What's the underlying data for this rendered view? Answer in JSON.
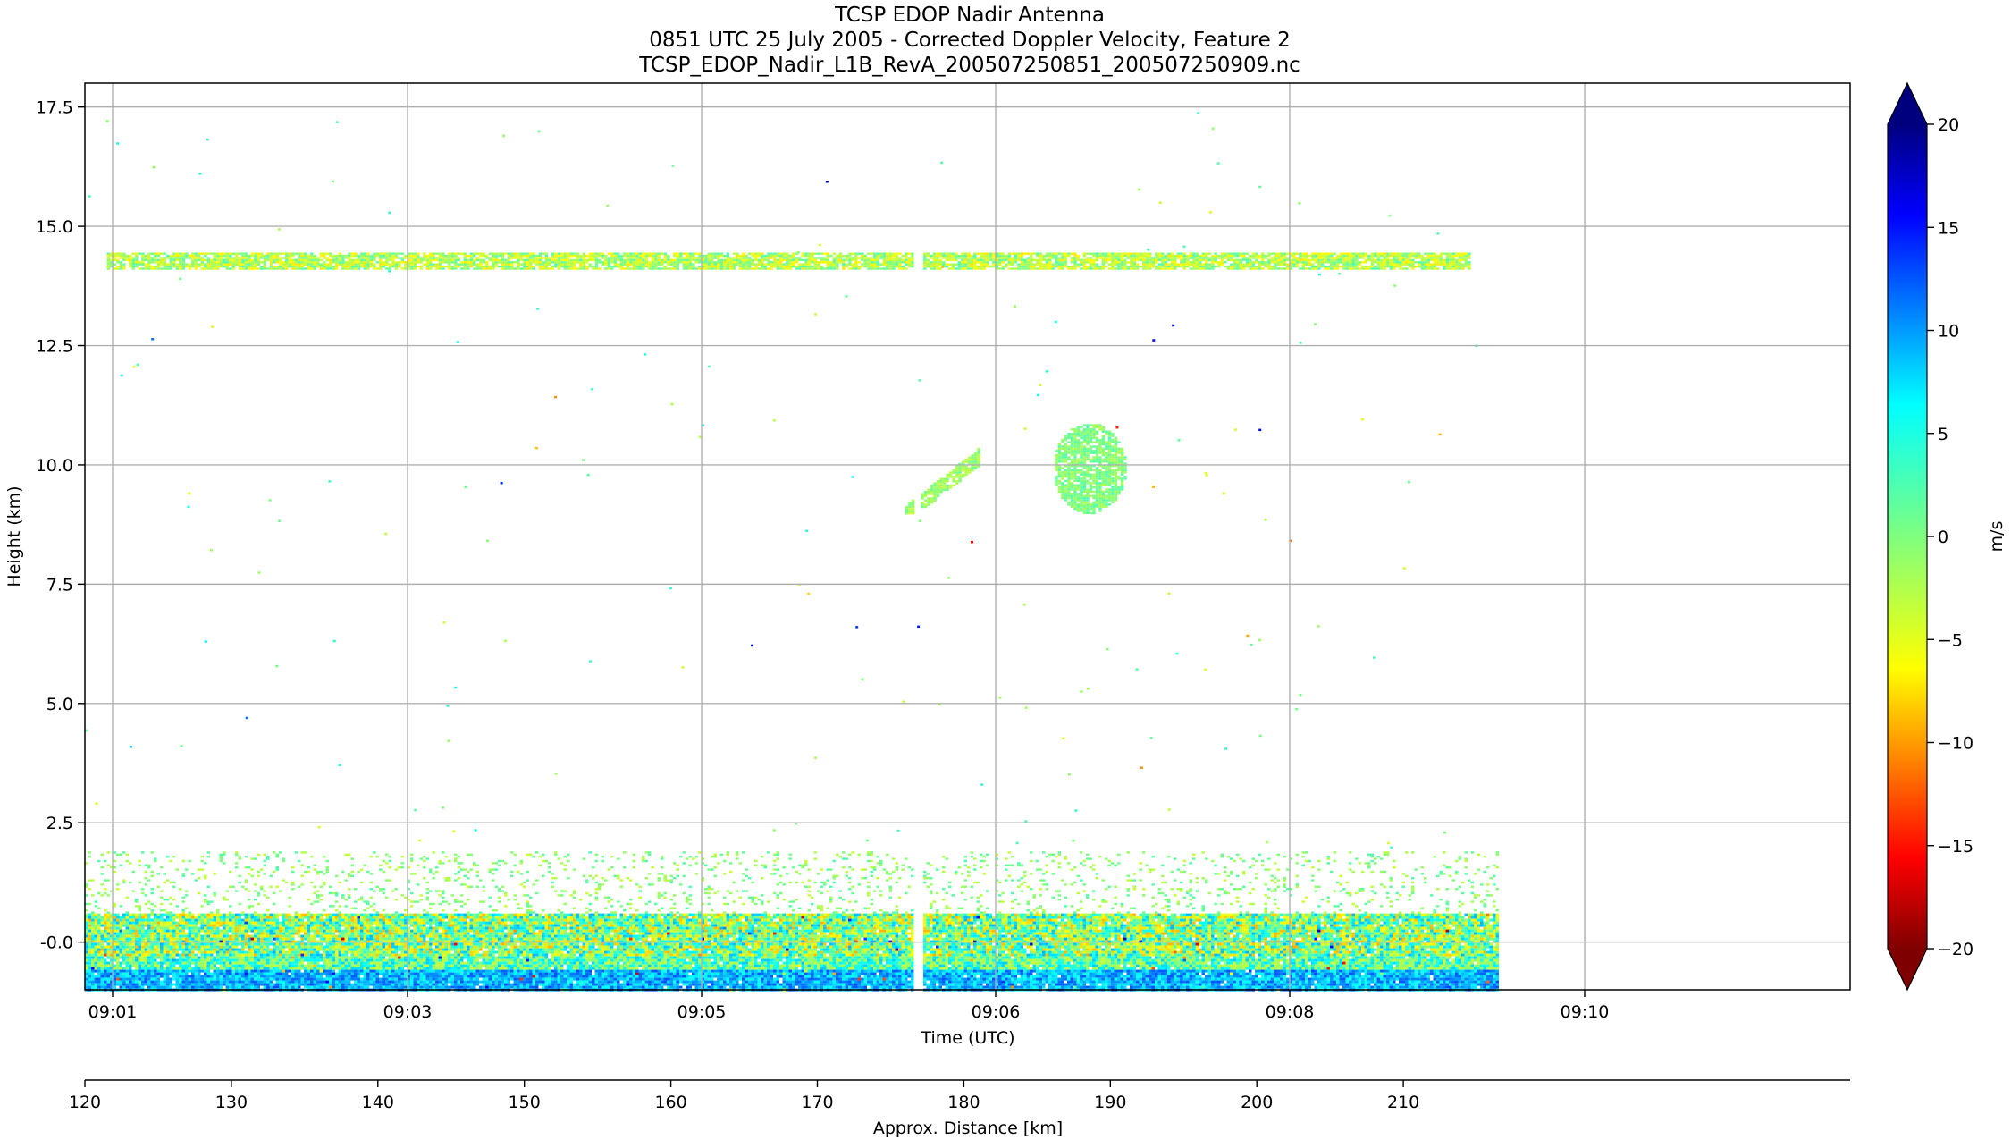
{
  "chart_data": {
    "type": "heatmap",
    "title_lines": [
      "TCSP EDOP Nadir Antenna",
      "0851 UTC 25 July 2005 - Corrected Doppler Velocity, Feature 2",
      "TCSP_EDOP_Nadir_L1B_RevA_200507250851_200507250909.nc"
    ],
    "xlabel": "Time (UTC)",
    "ylabel": "Height (km)",
    "x2label": "Approx. Distance [km]",
    "colorbar_label": "m/s",
    "xticks": [
      "09:01",
      "09:03",
      "09:05",
      "09:06",
      "09:08",
      "09:10"
    ],
    "yticks": [
      "-0.0",
      "2.5",
      "5.0",
      "7.5",
      "10.0",
      "12.5",
      "15.0",
      "17.5"
    ],
    "ytick_values": [
      0,
      2.5,
      5,
      7.5,
      10,
      12.5,
      15,
      17.5
    ],
    "ylim": [
      -1,
      18
    ],
    "x2ticks": [
      "120",
      "130",
      "140",
      "150",
      "160",
      "170",
      "180",
      "190",
      "200",
      "210"
    ],
    "x2lim": [
      120,
      240.5
    ],
    "colorbar_ticks": [
      "20",
      "15",
      "10",
      "5",
      "0",
      "−5",
      "−10",
      "−15",
      "−20"
    ],
    "colorbar_tick_values": [
      20,
      15,
      10,
      5,
      0,
      -5,
      -10,
      -15,
      -20
    ],
    "colorbar_range": [
      -20,
      20
    ],
    "colormap": [
      "#7f0000",
      "#ff0000",
      "#ff7f00",
      "#ffff00",
      "#7fff7f",
      "#00ffff",
      "#007fff",
      "#0000ff",
      "#00007f"
    ],
    "grid": true,
    "features": [
      {
        "name": "anvil cirrus layer",
        "x_km": [
          121.5,
          214.5
        ],
        "height_km": [
          14.1,
          14.45
        ],
        "velocity_ms": [
          -6,
          2
        ]
      },
      {
        "name": "mid-level echo",
        "x_km": [
          176,
          181
        ],
        "height_km": [
          9.0,
          10.4
        ],
        "velocity_ms": [
          -3,
          1
        ]
      },
      {
        "name": "mid-level echo",
        "x_km": [
          186,
          191
        ],
        "height_km": [
          9.0,
          10.9
        ],
        "velocity_ms": [
          -2,
          2
        ]
      },
      {
        "name": "boundary layer echo",
        "x_km": [
          120,
          216.5
        ],
        "height_km": [
          -1.0,
          0.6
        ],
        "velocity_ms": [
          -8,
          8
        ]
      },
      {
        "name": "low cloud layer",
        "x_km": [
          120,
          216.5
        ],
        "height_km": [
          0.6,
          1.9
        ],
        "velocity_ms": [
          -3,
          2
        ]
      }
    ],
    "data_gap_x_km": 176.8,
    "data_end_x_km": 216.5
  }
}
